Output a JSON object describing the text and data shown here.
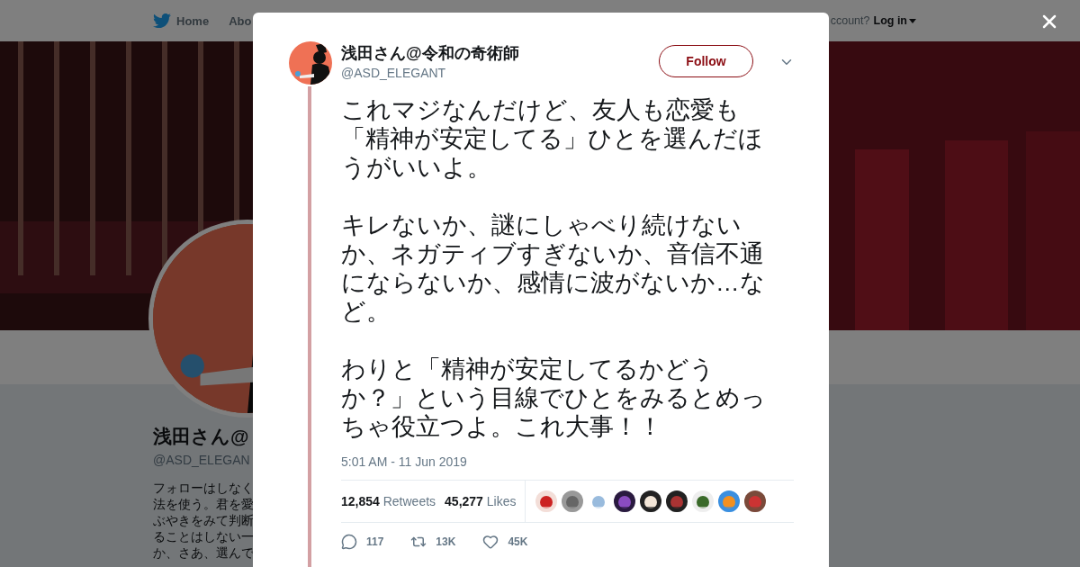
{
  "topbar": {
    "nav": [
      {
        "label": "Home"
      },
      {
        "label": "Abo"
      }
    ],
    "account_prompt": "ccount?",
    "login": "Log in"
  },
  "profile": {
    "name": "浅田さん@",
    "handle": "@ASD_ELEGAN",
    "bio_lines": [
      "フォローはしなく",
      "法を使う。君を愛",
      "ぶやきをみて判断",
      "ることはしない一",
      "か、さあ、選んで"
    ]
  },
  "tweet": {
    "name": "浅田さん@令和の奇術師",
    "handle": "@ASD_ELEGANT",
    "follow": "Follow",
    "paragraphs": [
      "これマジなんだけど、友人も恋愛も「精神が安定してる」ひとを選んだほうがいいよ。",
      "キレないか、謎にしゃべり続けないか、ネガティブすぎないか、音信不通にならないか、感情に波がないか…など。",
      "わりと「精神が安定してるかどうか？」という目線でひとをみるとめっちゃ役立つよ。これ大事！！"
    ],
    "timestamp": "5:01 AM - 11 Jun 2019",
    "retweets_count": "12,854",
    "retweets_label": "Retweets",
    "likes_count": "45,277",
    "likes_label": "Likes",
    "actions": [
      {
        "kind": "reply",
        "count": "117"
      },
      {
        "kind": "retweet",
        "count": "13K"
      },
      {
        "kind": "like",
        "count": "45K"
      }
    ]
  }
}
